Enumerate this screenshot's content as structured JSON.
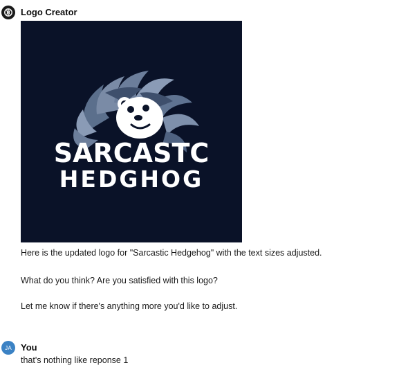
{
  "assistant": {
    "name": "Logo Creator",
    "avatar_icon": "openai-logo-icon",
    "logo_image": {
      "line1": "SARCASTC",
      "line2": "HEDGHOG",
      "background_color": "#0a1228"
    },
    "paragraphs": [
      "Here is the updated logo for \"Sarcastic Hedgehog\" with the text sizes adjusted.",
      "What do you think? Are you satisfied with this logo?",
      "Let me know if there's anything more you'd like to adjust."
    ]
  },
  "user": {
    "name": "You",
    "initials": "JA",
    "avatar_color": "#3b82c4",
    "message": "that's nothing like reponse 1"
  }
}
